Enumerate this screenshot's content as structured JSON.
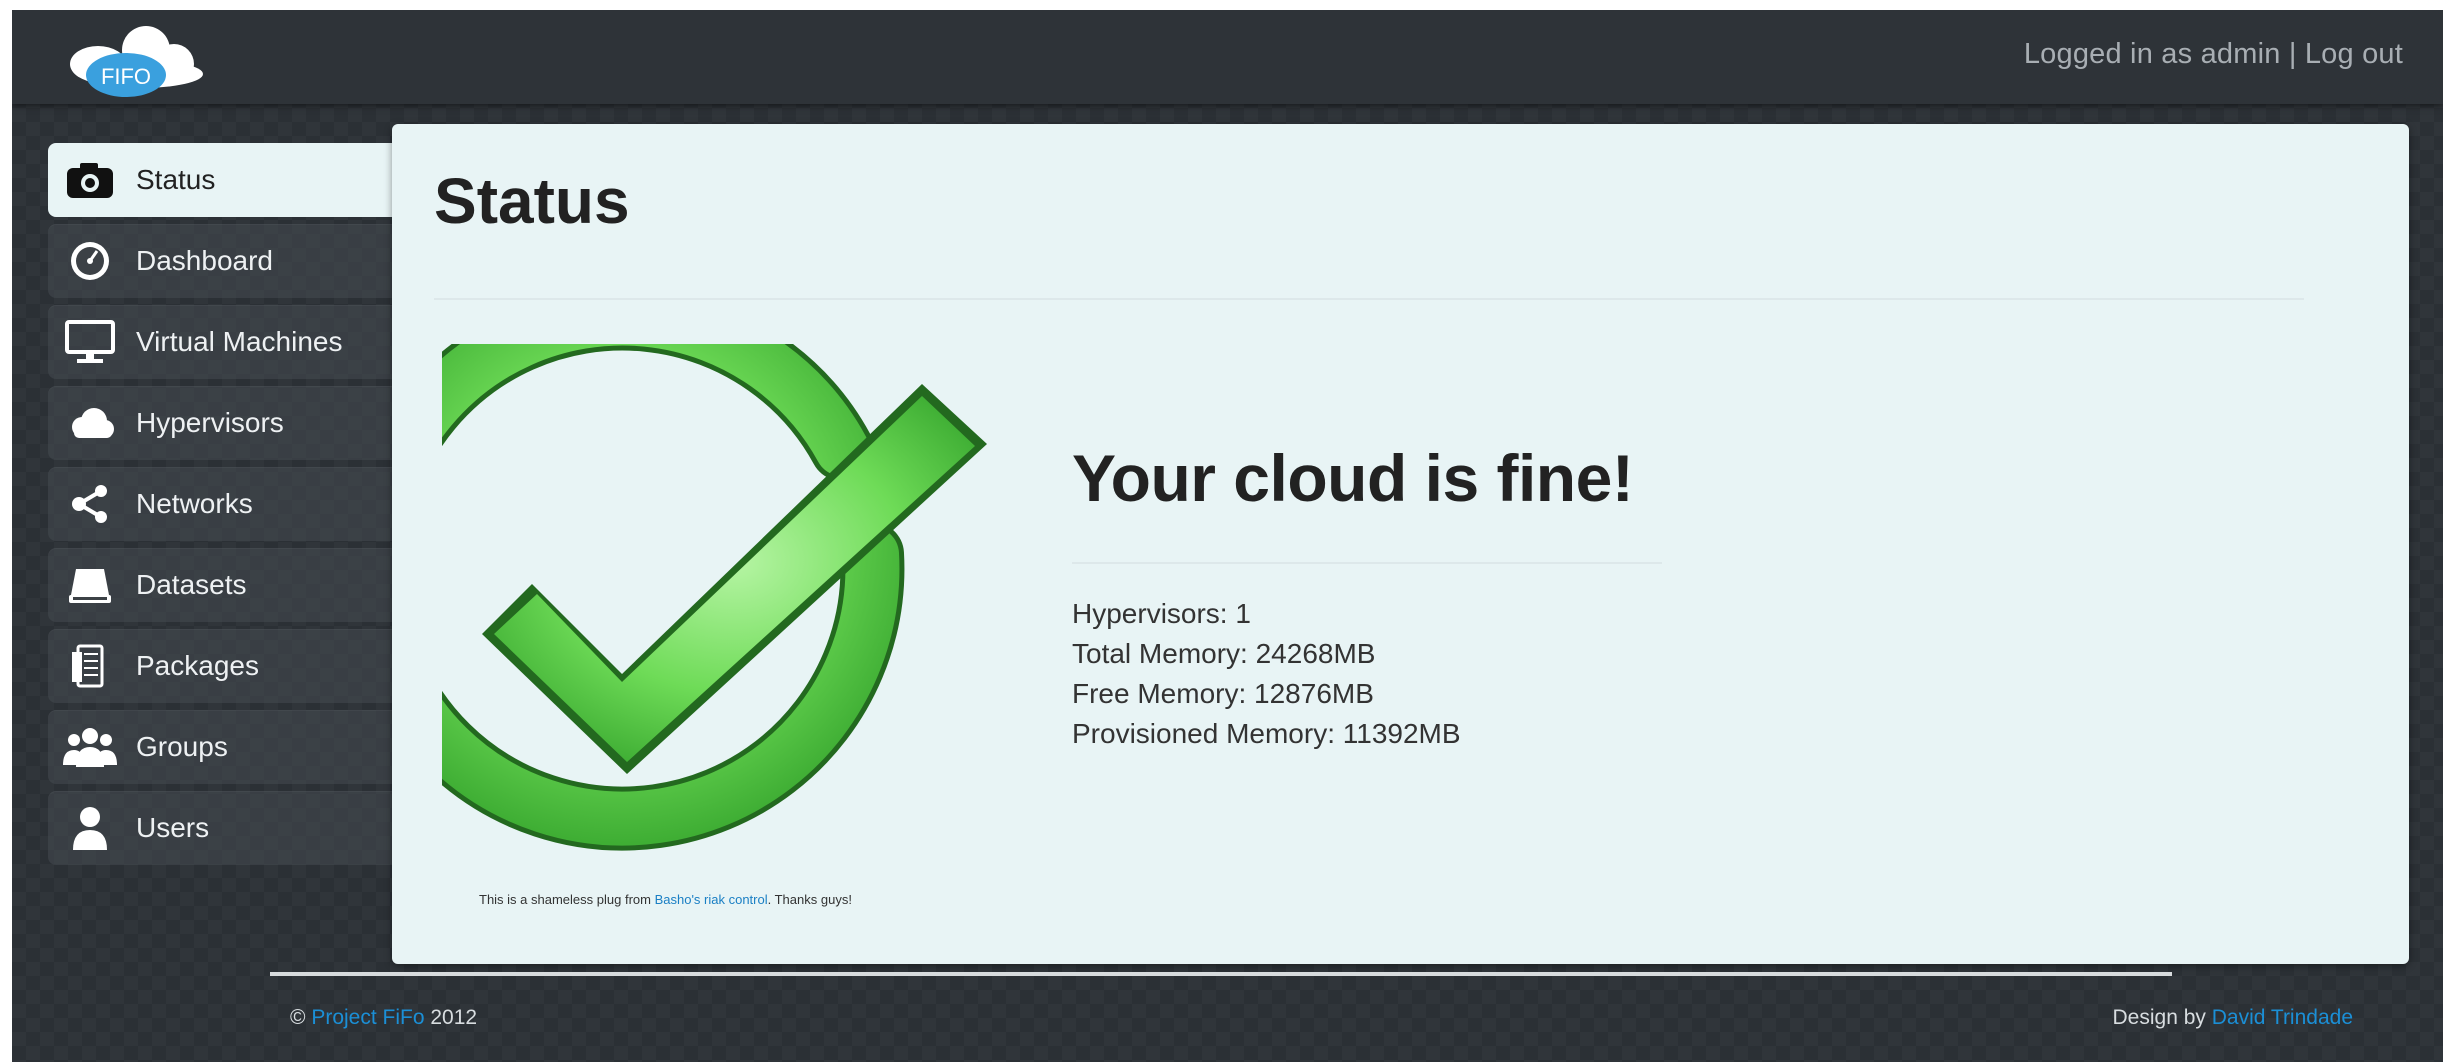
{
  "header": {
    "logo_text": "FIFO",
    "logged_in_text": "Logged in as admin",
    "separator": "|",
    "logout_label": "Log out"
  },
  "sidebar": {
    "items": [
      {
        "label": "Status",
        "icon": "camera-icon",
        "active": true
      },
      {
        "label": "Dashboard",
        "icon": "gauge-icon"
      },
      {
        "label": "Virtual Machines",
        "icon": "monitor-icon"
      },
      {
        "label": "Hypervisors",
        "icon": "cloud-icon"
      },
      {
        "label": "Networks",
        "icon": "share-icon"
      },
      {
        "label": "Datasets",
        "icon": "disk-icon"
      },
      {
        "label": "Packages",
        "icon": "packages-icon"
      },
      {
        "label": "Groups",
        "icon": "group-icon"
      },
      {
        "label": "Users",
        "icon": "user-icon"
      }
    ]
  },
  "main": {
    "title": "Status",
    "headline": "Your cloud is fine!",
    "stats": [
      "Hypervisors: 1",
      "Total Memory: 24268MB",
      "Free Memory: 12876MB",
      "Provisioned Memory: 11392MB"
    ],
    "plug_prefix": "This is a shameless plug from ",
    "plug_link": "Basho's riak control",
    "plug_suffix": ". Thanks guys!"
  },
  "footer": {
    "copyright_symbol": "©",
    "project_link": "Project FiFo",
    "year": "2012",
    "design_by": "Design by",
    "designer_link": "David Trindade"
  },
  "colors": {
    "accent_link": "#1b8fd6",
    "check_green": "#5fd64a",
    "panel_bg": "#e8f4f5",
    "frame_bg": "#2b3035"
  }
}
